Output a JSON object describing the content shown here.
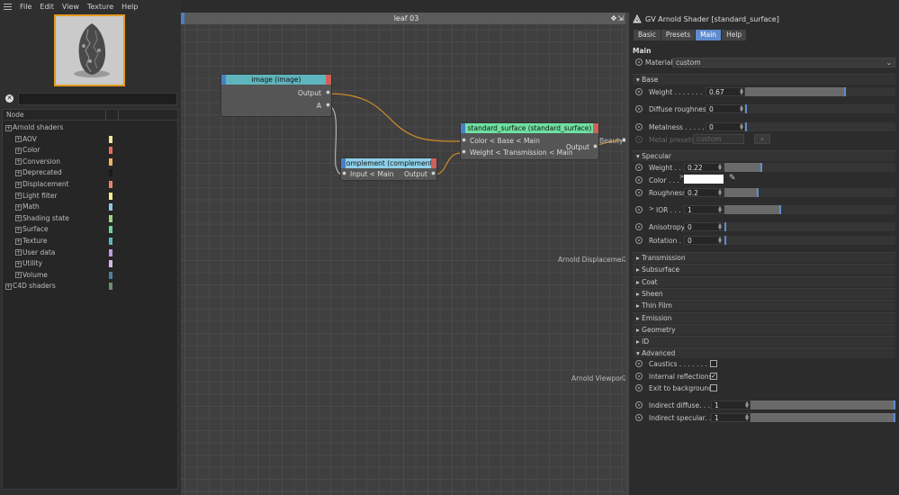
{
  "menu": {
    "items": [
      "File",
      "Edit",
      "View",
      "Texture",
      "Help"
    ]
  },
  "search": {
    "value": ""
  },
  "tree": {
    "header": "Node",
    "items": [
      {
        "label": "Arnold shaders",
        "level": 0,
        "color": ""
      },
      {
        "label": "AOV",
        "level": 1,
        "color": "#f4e59a"
      },
      {
        "label": "Color",
        "level": 1,
        "color": "#e56c5b"
      },
      {
        "label": "Conversion",
        "level": 1,
        "color": "#efb45c"
      },
      {
        "label": "Deprecated",
        "level": 1,
        "color": "#1a1a1a"
      },
      {
        "label": "Displacement",
        "level": 1,
        "color": "#e2866a"
      },
      {
        "label": "Light filter",
        "level": 1,
        "color": "#f6ee8e"
      },
      {
        "label": "Math",
        "level": 1,
        "color": "#8fc6e6"
      },
      {
        "label": "Shading state",
        "level": 1,
        "color": "#9fd57c"
      },
      {
        "label": "Surface",
        "level": 1,
        "color": "#6fd39b"
      },
      {
        "label": "Texture",
        "level": 1,
        "color": "#5ab8c0"
      },
      {
        "label": "User data",
        "level": 1,
        "color": "#c29adf"
      },
      {
        "label": "Utility",
        "level": 1,
        "color": "#d7b4e8"
      },
      {
        "label": "Volume",
        "level": 1,
        "color": "#4f7fa0"
      },
      {
        "label": "C4D shaders",
        "level": 0,
        "color": "#6b8f6f"
      }
    ]
  },
  "graph": {
    "title": "leaf 03",
    "nodes": {
      "image": {
        "title": "image (image)",
        "color": "#5fb5bd",
        "out": "Output",
        "in": "A"
      },
      "complement": {
        "title": "complement (complement)",
        "color": "#8fd1ea",
        "in": "Input < Main",
        "out": "Output"
      },
      "standard": {
        "title": "standard_surface (standard_surface)",
        "color": "#6fe0a0",
        "in1": "Color < Base < Main",
        "in2": "Weight < Transmission < Main",
        "out": "Output"
      }
    },
    "labels": {
      "beauty": "Beauty",
      "displacement": "Arnold Displacement",
      "viewport": "Arnold Viewport"
    }
  },
  "attr": {
    "title": "GV Arnold Shader [standard_surface]",
    "tabs": [
      "Basic",
      "Presets",
      "Main",
      "Help"
    ],
    "active_tab": "Main",
    "section_main": "Main",
    "material_label": "Material",
    "material_value": "custom",
    "base": {
      "header": "Base",
      "weight": {
        "label": "Weight . . . . . . .",
        "value": "0.67",
        "frac": 0.67
      },
      "diffuse_roughness": {
        "label": "Diffuse roughness",
        "value": "0",
        "frac": 0
      },
      "metalness": {
        "label": "Metalness . . . . .",
        "value": "0",
        "frac": 0
      },
      "metal_presets": {
        "label": "Metal presets",
        "value": "custom",
        "btn": "»"
      }
    },
    "specular": {
      "header": "Specular",
      "weight": {
        "label": "Weight . . .",
        "value": "0.22",
        "frac": 0.22
      },
      "color": {
        "label": "Color . . .",
        "swatch": "#ffffff"
      },
      "roughness": {
        "label": "Roughness",
        "value": "0.2",
        "frac": 0.2
      },
      "ior": {
        "label": "IOR . . .",
        "value": "1",
        "frac": 0.33
      },
      "anisotropy": {
        "label": "Anisotropy",
        "value": "0",
        "frac": 0
      },
      "rotation": {
        "label": "Rotation .",
        "value": "0",
        "frac": 0
      }
    },
    "collapsed": [
      "Transmission",
      "Subsurface",
      "Coat",
      "Sheen",
      "Thin Film",
      "Emission",
      "Geometry",
      "ID"
    ],
    "advanced": {
      "header": "Advanced",
      "caustics": {
        "label": "Caustics . . . . . . . .",
        "checked": false
      },
      "internal_reflections": {
        "label": "Internal reflections",
        "checked": true
      },
      "exit_to_background": {
        "label": "Exit to background*",
        "checked": false
      },
      "indirect_diffuse": {
        "label": "Indirect diffuse. . .",
        "value": "1",
        "frac": 1
      },
      "indirect_specular": {
        "label": "Indirect specular. .",
        "value": "1",
        "frac": 1
      }
    }
  }
}
